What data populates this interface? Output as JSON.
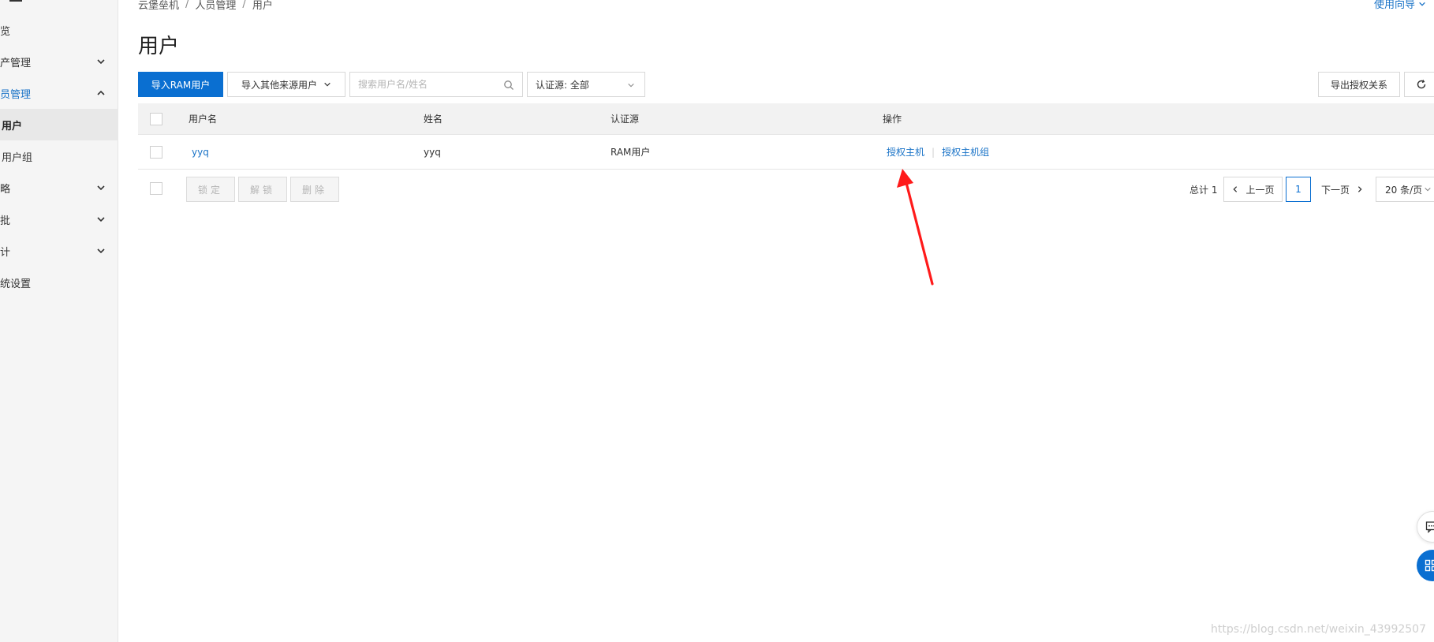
{
  "sidebar": {
    "items": [
      {
        "label": "览",
        "chevron": ""
      },
      {
        "label": "产管理",
        "chevron": "down"
      },
      {
        "label": "员管理",
        "chevron": "up"
      },
      {
        "label": "用户",
        "chevron": ""
      },
      {
        "label": "用户组",
        "chevron": ""
      },
      {
        "label": "略",
        "chevron": "down"
      },
      {
        "label": "批",
        "chevron": "down"
      },
      {
        "label": "计",
        "chevron": "down"
      },
      {
        "label": "统设置",
        "chevron": ""
      }
    ]
  },
  "header": {
    "breadcrumb": [
      "云堡垒机",
      "人员管理",
      "用户"
    ],
    "breadcrumb_sep": "/",
    "guide_label": "使用向导",
    "title": "用户"
  },
  "toolbar": {
    "import_ram_label": "导入RAM用户",
    "import_other_label": "导入其他来源用户",
    "search_placeholder": "搜索用户名/姓名",
    "auth_source_label": "认证源: 全部",
    "export_label": "导出授权关系",
    "refresh_icon": "refresh-icon"
  },
  "table": {
    "columns": [
      "用户名",
      "姓名",
      "认证源",
      "操作"
    ],
    "rows": [
      {
        "username": "yyq",
        "name": "yyq",
        "auth_source": "RAM用户",
        "actions": [
          "授权主机",
          "授权主机组"
        ]
      }
    ]
  },
  "bulk_actions": [
    "锁定",
    "解锁",
    "删除"
  ],
  "pagination": {
    "total_label": "总计 1",
    "prev_label": "上一页",
    "current_page": "1",
    "next_label": "下一页",
    "page_size_label": "20 条/页"
  },
  "watermark": "https://blog.csdn.net/weixin_43992507",
  "colors": {
    "primary": "#0a6fd1",
    "link": "#1a73c7",
    "annotation": "#ff1a1a"
  }
}
